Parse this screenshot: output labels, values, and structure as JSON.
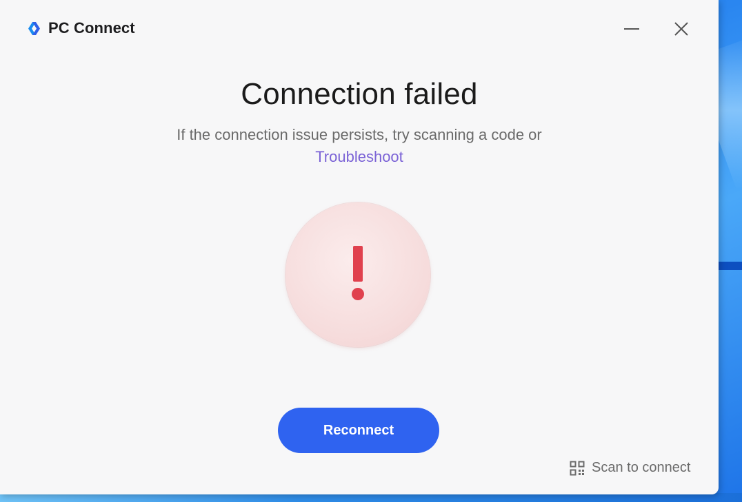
{
  "app": {
    "name": "PC Connect",
    "logo_icon": "pc-connect-logo-icon"
  },
  "window_controls": {
    "minimize_icon": "minimize-icon",
    "close_icon": "close-icon"
  },
  "main": {
    "title": "Connection failed",
    "message": "If the connection issue persists, try scanning a code or",
    "link_label": "Troubleshoot",
    "status_icon": "exclamation-icon",
    "primary_button_label": "Reconnect",
    "secondary_action_label": "Scan to connect",
    "secondary_action_icon": "qr-code-icon"
  },
  "colors": {
    "accent": "#2f63f0",
    "link": "#7b63d6",
    "error": "#e0414e",
    "error_bg": "#f6dcdc",
    "window_bg": "#f7f7f8"
  }
}
